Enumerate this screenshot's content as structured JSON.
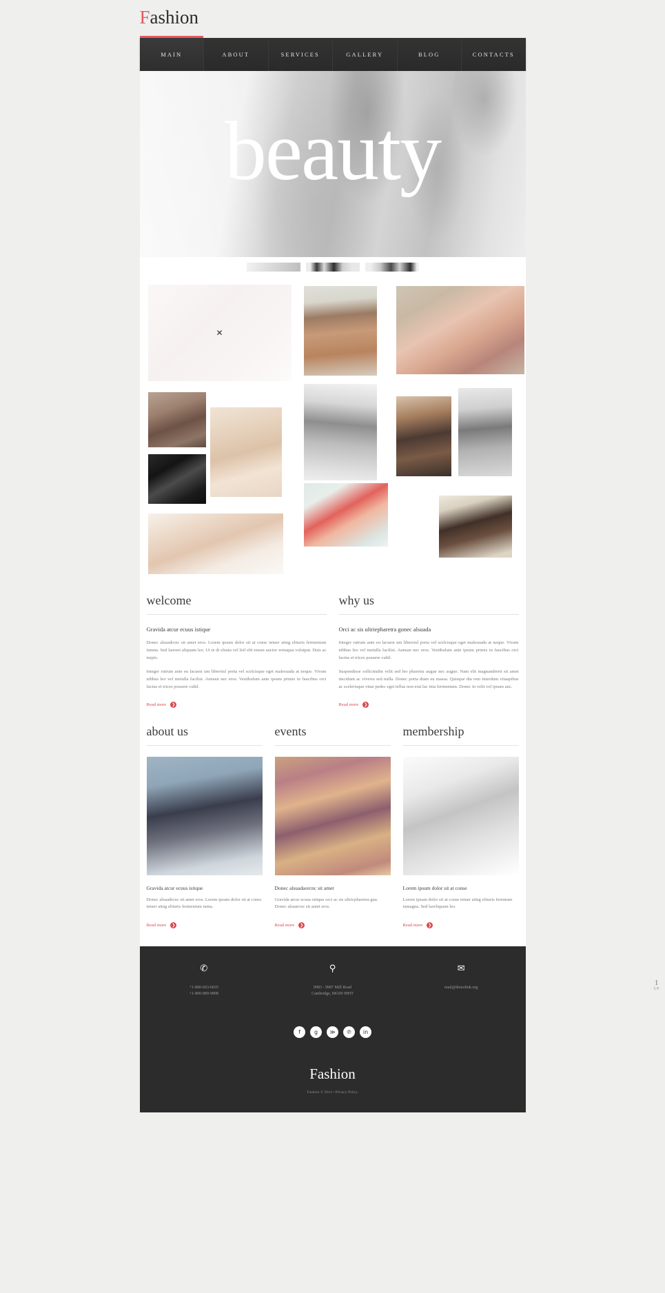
{
  "header": {
    "logo_first": "F",
    "logo_rest": "ashion"
  },
  "nav": {
    "items": [
      {
        "label": "MAIN",
        "active": true
      },
      {
        "label": "ABOUT",
        "active": false
      },
      {
        "label": "SERVICES",
        "active": false
      },
      {
        "label": "GALLERY",
        "active": false
      },
      {
        "label": "BLOG",
        "active": false
      },
      {
        "label": "CONTACTS",
        "active": false
      }
    ]
  },
  "hero": {
    "caption": "beauty"
  },
  "slider": {
    "thumbs": [
      {
        "active": true
      },
      {
        "active": false
      },
      {
        "active": false
      }
    ]
  },
  "gallery": {
    "close_glyph": "✕",
    "items": [
      {
        "name": "gallery-item-bride"
      },
      {
        "name": "gallery-item-hooded-man"
      },
      {
        "name": "gallery-item-earrings-woman"
      },
      {
        "name": "gallery-item-portrait-woman"
      },
      {
        "name": "gallery-item-blonde-woman"
      },
      {
        "name": "gallery-item-long-hair-bw"
      },
      {
        "name": "gallery-item-brunette-dress"
      },
      {
        "name": "gallery-item-dancer-bw"
      },
      {
        "name": "gallery-item-bw-profile"
      },
      {
        "name": "gallery-item-body-white"
      },
      {
        "name": "gallery-item-red-dress-heels"
      },
      {
        "name": "gallery-item-curly-man"
      }
    ]
  },
  "welcome": {
    "title": "welcome",
    "subtitle": "Gravida atcur ecuus istique",
    "paragraph1": "Donec alsuadrcnc sit amet eros. Lorem ipsum dolor sit at consc tetuer aiing elituris fermentum tumna. Sed laoreet aliquam leo. Ut te dt eleatu vel leif elit enean auctor wrnaqua volutpat. Duis ac turpis.",
    "paragraph2": "Integer rutrum ante eu lacuest um liberoisl porta vel scelcisque eget malesuada at neque. Vivam nibhus leo vel metulla facilisi. Aenean nec eros. Vestibulum ante ipsum primis in faucibus orci luctus et trices posuere cubil.",
    "read_more": "Read more"
  },
  "why_us": {
    "title": "why us",
    "subtitle": "Orci ac sis ultriepharetra gonec alsuada",
    "paragraph1": "Integer rutrum ante eu lacuest um liberoisl porta vel scelcisque eget malesuada at neque. Vivam nibhus leo vel metulla facilisi. Aenean nec eros. Vestibulum ante ipsum primis in faucibus orci luctus et trices posuere cubil.",
    "paragraph2": "Suspendisse sollicitudin velit sed leo pharetra augue nec augue. Nam elit magnandrerit sit amet tincidunt ac viverra sed nulla. Donec porta diam eu massa. Quisque dia rem interdum vitaapibus ac scelerisque vitae pedec eget tellus non erat lac inia fermentum. Donec in velit vel ipsum auc.",
    "read_more": "Read more"
  },
  "columns": [
    {
      "title": "about us",
      "subtitle": "Gravida atcur ecuus istique",
      "text": "Donec alsuadrcnc sit amet eros. Lorem ipsum dolor sit at consc tetuer aiing elituris fermentum tuma.",
      "read_more": "Read more",
      "image_name": "about-us-image"
    },
    {
      "title": "events",
      "subtitle": "Donec alsuadaorcnc sit amet",
      "text": "Gravida atcur ecuus istique orci ac sis ultricpharetra gna. Donec alsuarcnc sit amet eros.",
      "read_more": "Read more",
      "image_name": "events-image"
    },
    {
      "title": "membership",
      "subtitle": "Lorem ipsum dolor sit at conse",
      "text": "Lorem ipsum dolor sit at conse tetuer aiing elituris ferentum tumagna. Sed laorliquam leo.",
      "read_more": "Read more",
      "image_name": "membership-image"
    }
  ],
  "footer": {
    "contacts": [
      {
        "icon": "phone-icon",
        "glyph": "✆",
        "line1": "+1-800-603-6035",
        "line2": "+1-800-889-9898"
      },
      {
        "icon": "location-pin-icon",
        "glyph": "⚲",
        "line1": "9983 - 9987 Mill Road",
        "line2": "Cambridge, MG09 99HT"
      },
      {
        "icon": "envelope-icon",
        "glyph": "✉",
        "line1": "mail@demolink.org",
        "line2": ""
      }
    ],
    "socials": [
      {
        "name": "facebook-icon",
        "glyph": "f"
      },
      {
        "name": "google-plus-icon",
        "glyph": "g"
      },
      {
        "name": "rss-icon",
        "glyph": "≫"
      },
      {
        "name": "pinterest-icon",
        "glyph": "℗"
      },
      {
        "name": "linkedin-icon",
        "glyph": "in"
      }
    ],
    "logo": "Fashion",
    "copyright": "Fashion © 2014 • Privacy Policy"
  },
  "side_badge": {
    "number": "1",
    "unit": "UP"
  },
  "colors": {
    "accent": "#d94a4f",
    "logo_accent": "#e4595e",
    "nav_bg": "#2c2c2c",
    "page_bg": "#efefed",
    "content_bg": "#ffffff",
    "body_text": "#7a7a7a"
  }
}
